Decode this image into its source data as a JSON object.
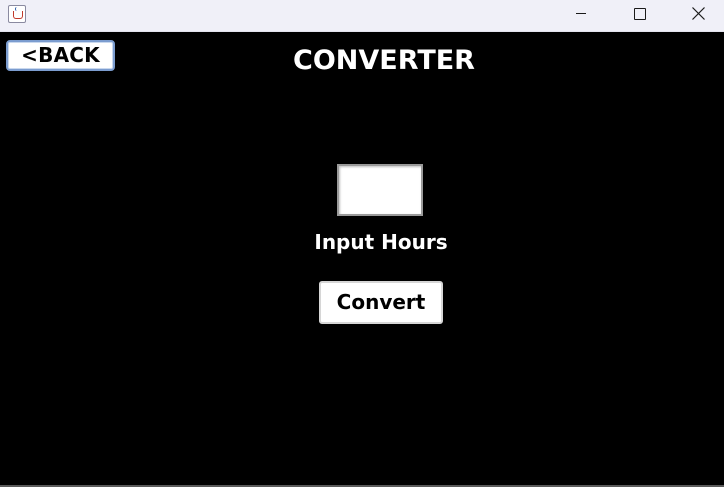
{
  "window": {
    "title": "",
    "icon": "java-cup-icon",
    "controls": [
      "minimize-icon",
      "maximize-icon",
      "close-icon"
    ]
  },
  "header": {
    "back_label": "<BACK",
    "title": "CONVERTER"
  },
  "form": {
    "hours_value": "",
    "hours_label": "Input Hours",
    "convert_label": "Convert"
  },
  "colors": {
    "background": "#000000",
    "text": "#ffffff",
    "button_bg": "#ffffff",
    "back_border": "#7b9ccf"
  }
}
